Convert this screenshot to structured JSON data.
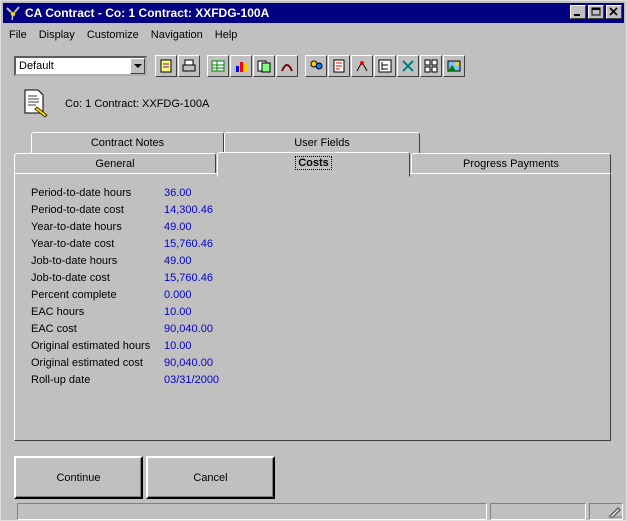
{
  "window": {
    "title": "CA Contract - Co: 1  Contract: XXFDG-100A",
    "buttons": [
      "minimize",
      "maximize",
      "close"
    ]
  },
  "menu": [
    "File",
    "Display",
    "Customize",
    "Navigation",
    "Help"
  ],
  "toolbar": {
    "view_select": "Default",
    "tools": [
      "note-icon",
      "print-icon",
      "grid-icon",
      "chart-icon",
      "forms-icon",
      "link-icon",
      "people-icon",
      "report-icon",
      "lookup-icon",
      "tree-icon",
      "tools-icon",
      "layout-icon",
      "image-icon"
    ]
  },
  "header": {
    "contract_label": "Co: 1  Contract: XXFDG-100A"
  },
  "tabs": {
    "back": [
      "Contract Notes",
      "User Fields"
    ],
    "front": [
      "General",
      "Costs",
      "Progress Payments"
    ],
    "active": "Costs"
  },
  "costs": [
    {
      "label": "Period-to-date hours",
      "value": "36.00"
    },
    {
      "label": "Period-to-date cost",
      "value": "14,300.46"
    },
    {
      "label": "Year-to-date hours",
      "value": "49.00"
    },
    {
      "label": "Year-to-date cost",
      "value": "15,760.46"
    },
    {
      "label": "Job-to-date hours",
      "value": "49.00"
    },
    {
      "label": "Job-to-date cost",
      "value": "15,760.46"
    },
    {
      "label": "Percent complete",
      "value": "0.000"
    },
    {
      "label": "EAC hours",
      "value": "10.00"
    },
    {
      "label": "EAC cost",
      "value": "90,040.00"
    },
    {
      "label": "Original estimated hours",
      "value": "10.00"
    },
    {
      "label": "Original estimated cost",
      "value": "90,040.00"
    },
    {
      "label": "Roll-up date",
      "value": "03/31/2000"
    }
  ],
  "actions": {
    "continue": "Continue",
    "cancel": "Cancel"
  },
  "colors": {
    "titlebar": "#000080",
    "value_text": "#0000d0",
    "face": "#c0c0c0"
  }
}
